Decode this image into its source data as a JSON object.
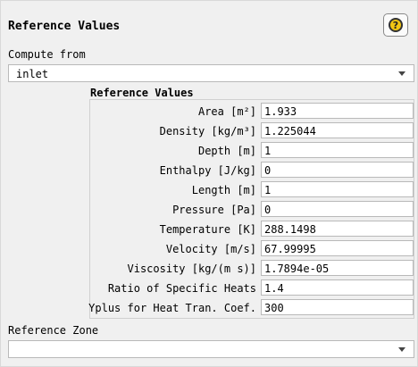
{
  "panel": {
    "title": "Reference Values",
    "help_icon": "question-mark-icon",
    "help_glyph": "?"
  },
  "compute_from": {
    "label": "Compute from",
    "value": "inlet"
  },
  "ref_group": {
    "title": "Reference Values",
    "rows": [
      {
        "label": "Area [m²]",
        "value": "1.933"
      },
      {
        "label": "Density [kg/m³]",
        "value": "1.225044"
      },
      {
        "label": "Depth [m]",
        "value": "1"
      },
      {
        "label": "Enthalpy [J/kg]",
        "value": "0"
      },
      {
        "label": "Length [m]",
        "value": "1"
      },
      {
        "label": "Pressure [Pa]",
        "value": "0"
      },
      {
        "label": "Temperature [K]",
        "value": "288.1498"
      },
      {
        "label": "Velocity [m/s]",
        "value": "67.99995"
      },
      {
        "label": "Viscosity [kg/(m s)]",
        "value": "1.7894e-05"
      },
      {
        "label": "Ratio of Specific Heats",
        "value": "1.4"
      },
      {
        "label": "Yplus for Heat Tran. Coef.",
        "value": "300"
      }
    ]
  },
  "reference_zone": {
    "label": "Reference Zone",
    "value": ""
  }
}
